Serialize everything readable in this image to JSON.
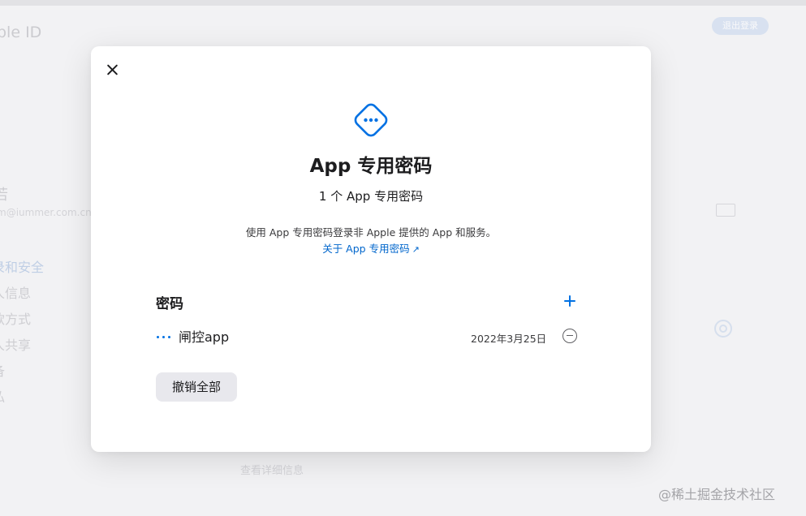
{
  "background": {
    "title": "ple ID",
    "signout_label": "退出登录",
    "account_name": "若",
    "account_email": "m@iummer.com.cn",
    "nav": [
      "录和安全",
      "人信息",
      "款方式",
      "人共享",
      "备",
      "私"
    ],
    "footer_link": "查看详细信息"
  },
  "modal": {
    "title": "App 专用密码",
    "subtitle": "1 个 App 专用密码",
    "description": "使用 App 专用密码登录非 Apple 提供的 App 和服务。",
    "learn_more_link": "关于 App 专用密码",
    "learn_more_arrow": "↗",
    "section_title": "密码",
    "passwords": [
      {
        "name": "闸控app",
        "date": "2022年3月25日"
      }
    ],
    "revoke_all_label": "撤销全部"
  },
  "icons": {
    "close": "close-icon",
    "header": "password-diamond-icon",
    "add": "plus-icon",
    "row": "dots-icon",
    "remove": "minus-circle-icon"
  },
  "colors": {
    "accent": "#0071e3",
    "link": "#0066cc",
    "text": "#1d1d1f"
  },
  "watermark": "@稀土掘金技术社区"
}
